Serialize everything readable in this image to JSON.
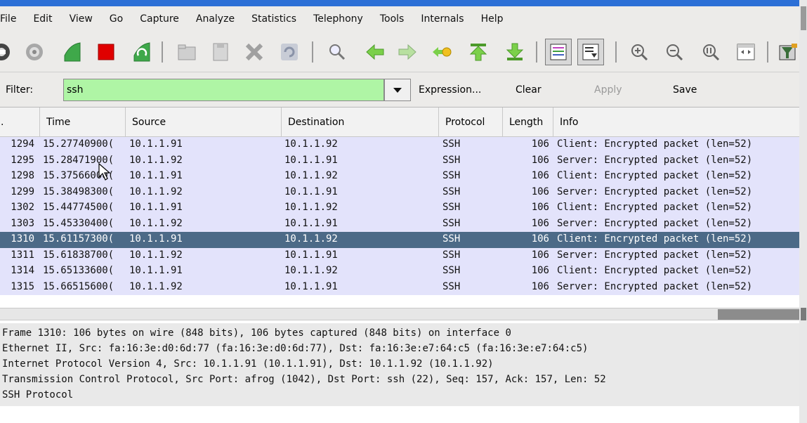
{
  "menu": [
    "File",
    "Edit",
    "View",
    "Go",
    "Capture",
    "Analyze",
    "Statistics",
    "Telephony",
    "Tools",
    "Internals",
    "Help"
  ],
  "toolbar": {
    "icons": [
      "interfaces-icon",
      "options-icon",
      "start-capture-icon",
      "stop-capture-icon",
      "restart-capture-icon",
      "open-file-icon",
      "save-file-icon",
      "close-file-icon",
      "reload-icon",
      "find-icon",
      "go-back-icon",
      "go-forward-icon",
      "go-to-packet-icon",
      "first-packet-icon",
      "last-packet-icon",
      "colorize-icon",
      "autoscroll-icon",
      "zoom-in-icon",
      "zoom-out-icon",
      "normal-size-icon",
      "resize-columns-icon",
      "capture-filters-icon"
    ]
  },
  "filter": {
    "label": "Filter:",
    "value": "ssh",
    "expression_label": "Expression...",
    "clear_label": "Clear",
    "apply_label": "Apply",
    "save_label": "Save"
  },
  "packet_list": {
    "columns": [
      ".",
      "Time",
      "Source",
      "Destination",
      "Protocol",
      "Length",
      "Info"
    ],
    "rows": [
      {
        "no": "1294",
        "time": "15.27740900(",
        "source": "10.1.1.91",
        "destination": "10.1.1.92",
        "protocol": "SSH",
        "length": "106",
        "info": "Client: Encrypted packet (len=52)"
      },
      {
        "no": "1295",
        "time": "15.28471900(",
        "source": "10.1.1.92",
        "destination": "10.1.1.91",
        "protocol": "SSH",
        "length": "106",
        "info": "Server: Encrypted packet (len=52)"
      },
      {
        "no": "1298",
        "time": "15.37566000(",
        "source": "10.1.1.91",
        "destination": "10.1.1.92",
        "protocol": "SSH",
        "length": "106",
        "info": "Client: Encrypted packet (len=52)"
      },
      {
        "no": "1299",
        "time": "15.38498300(",
        "source": "10.1.1.92",
        "destination": "10.1.1.91",
        "protocol": "SSH",
        "length": "106",
        "info": "Server: Encrypted packet (len=52)"
      },
      {
        "no": "1302",
        "time": "15.44774500(",
        "source": "10.1.1.91",
        "destination": "10.1.1.92",
        "protocol": "SSH",
        "length": "106",
        "info": "Client: Encrypted packet (len=52)"
      },
      {
        "no": "1303",
        "time": "15.45330400(",
        "source": "10.1.1.92",
        "destination": "10.1.1.91",
        "protocol": "SSH",
        "length": "106",
        "info": "Server: Encrypted packet (len=52)"
      },
      {
        "no": "1310",
        "time": "15.61157300(",
        "source": "10.1.1.91",
        "destination": "10.1.1.92",
        "protocol": "SSH",
        "length": "106",
        "info": "Client: Encrypted packet (len=52)"
      },
      {
        "no": "1311",
        "time": "15.61838700(",
        "source": "10.1.1.92",
        "destination": "10.1.1.91",
        "protocol": "SSH",
        "length": "106",
        "info": "Server: Encrypted packet (len=52)"
      },
      {
        "no": "1314",
        "time": "15.65133600(",
        "source": "10.1.1.91",
        "destination": "10.1.1.92",
        "protocol": "SSH",
        "length": "106",
        "info": "Client: Encrypted packet (len=52)"
      },
      {
        "no": "1315",
        "time": "15.66515600(",
        "source": "10.1.1.92",
        "destination": "10.1.1.91",
        "protocol": "SSH",
        "length": "106",
        "info": "Server: Encrypted packet (len=52)"
      }
    ],
    "selected_index": 6
  },
  "details": [
    "Frame 1310: 106 bytes on wire (848 bits), 106 bytes captured (848 bits) on interface 0",
    "Ethernet II, Src: fa:16:3e:d0:6d:77 (fa:16:3e:d0:6d:77), Dst: fa:16:3e:e7:64:c5 (fa:16:3e:e7:64:c5)",
    "Internet Protocol Version 4, Src: 10.1.1.91 (10.1.1.91), Dst: 10.1.1.92 (10.1.1.92)",
    "Transmission Control Protocol, Src Port: afrog (1042), Dst Port: ssh (22), Seq: 157, Ack: 157, Len: 52",
    "SSH Protocol"
  ],
  "colors": {
    "filter_valid_bg": "#aff5a5",
    "row_bg": "#e3e3fb",
    "selected_row_bg": "#4c6a87"
  }
}
